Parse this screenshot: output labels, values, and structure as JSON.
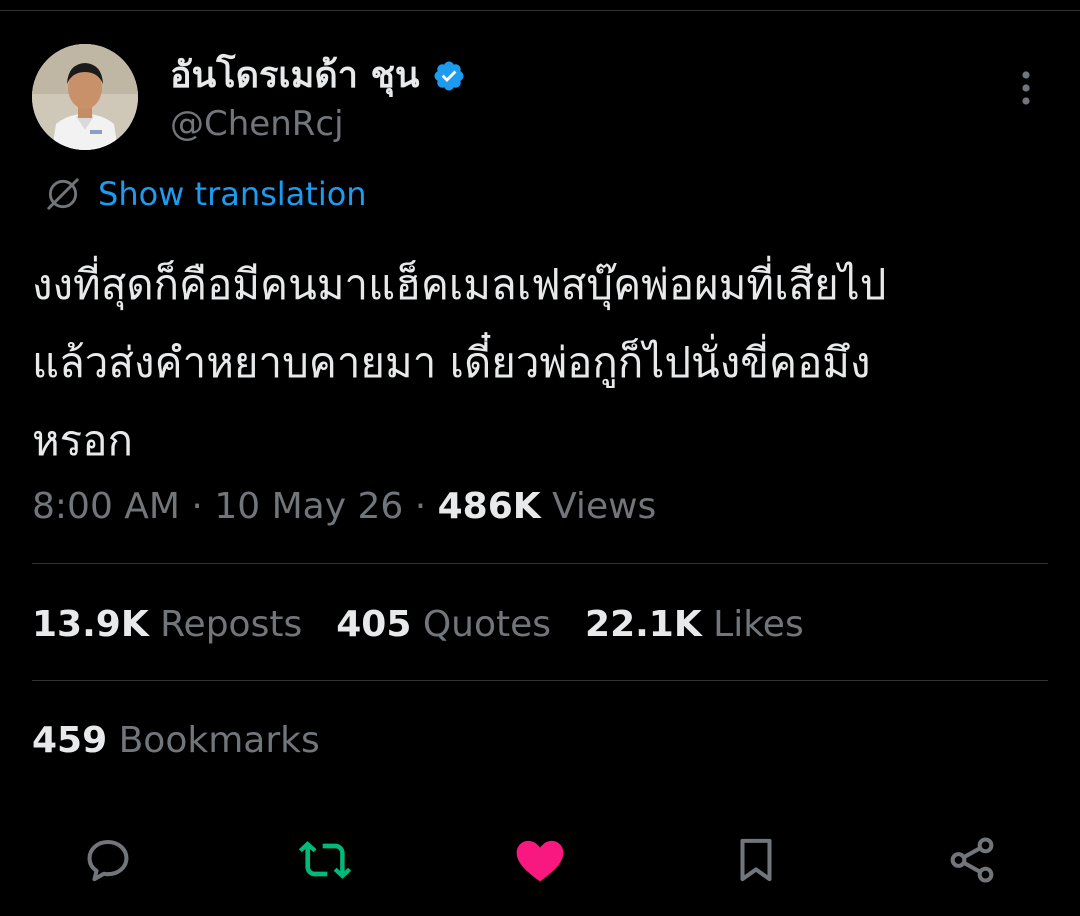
{
  "author": {
    "display_name": "อันโดรเมด้า ชุน",
    "handle": "@ChenRcj",
    "verified": true
  },
  "translate": {
    "label": "Show translation"
  },
  "tweet": {
    "text": "งงที่สุดก็คือมีคนมาแฮ็คเมลเฟสบุ๊คพ่อผมที่เสียไป\nแล้วส่งคำหยาบคายมา เดี๋ยวพ่อกูก็ไปนั่งขี่คอมึง\nหรอก"
  },
  "meta": {
    "time": "8:00 AM",
    "sep1": " · ",
    "date": "10 May 26",
    "sep2": " · ",
    "views_count": "486K",
    "views_label": " Views"
  },
  "stats": {
    "reposts_count": "13.9K",
    "reposts_label": " Reposts",
    "quotes_count": "405",
    "quotes_label": " Quotes",
    "likes_count": "22.1K",
    "likes_label": " Likes",
    "bookmarks_count": "459",
    "bookmarks_label": " Bookmarks"
  },
  "icons": {
    "translate": "globe-slash-icon",
    "more": "more-vertical-icon",
    "reply": "reply-bubble-icon",
    "repost": "repost-icon",
    "like": "heart-icon",
    "bookmark": "bookmark-icon",
    "share": "share-icon"
  },
  "colors": {
    "background": "#000000",
    "text": "#e7e9ea",
    "secondary": "#71767b",
    "accent": "#1d9bf0",
    "repost_active": "#00ba7c",
    "like_active": "#f91880",
    "divider": "#2f3336"
  }
}
